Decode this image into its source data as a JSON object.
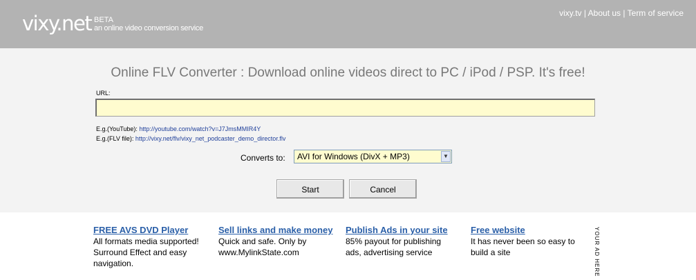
{
  "header": {
    "logo": "vixy.net",
    "beta": "BETA",
    "tagline": "an online video conversion service",
    "links": [
      "vixy.tv",
      "About us",
      "Term of service"
    ],
    "separator": "|"
  },
  "main": {
    "headline": "Online FLV Converter : Download online videos direct to PC / iPod / PSP. It's free!",
    "url_label": "URL:",
    "url_value": "",
    "examples": [
      {
        "label": "E.g.(YouTube):",
        "link": "http://youtube.com/watch?v=J7JmsMMIR4Y"
      },
      {
        "label": "E.g.(FLV file):",
        "link": "http://vixy.net/flv/vixy_net_podcaster_demo_director.flv"
      }
    ],
    "convert_label": "Converts to:",
    "format_selected": "AVI for Windows (DivX + MP3)",
    "start_label": "Start",
    "cancel_label": "Cancel"
  },
  "ads": [
    {
      "title": "FREE AVS DVD Player",
      "lines": [
        "All formats media supported!",
        "Surround Effect and easy",
        "navigation."
      ]
    },
    {
      "title": "Sell links and make money",
      "lines": [
        "Quick and safe. Only by",
        "www.MylinkState.com"
      ]
    },
    {
      "title": "Publish Ads in your site",
      "lines": [
        "85% payout for publishing",
        "ads, advertising service"
      ]
    },
    {
      "title": "Free website",
      "lines": [
        "It has never been so easy to",
        "build a site"
      ]
    }
  ],
  "your_ad_here": "YOUR AD HERE"
}
